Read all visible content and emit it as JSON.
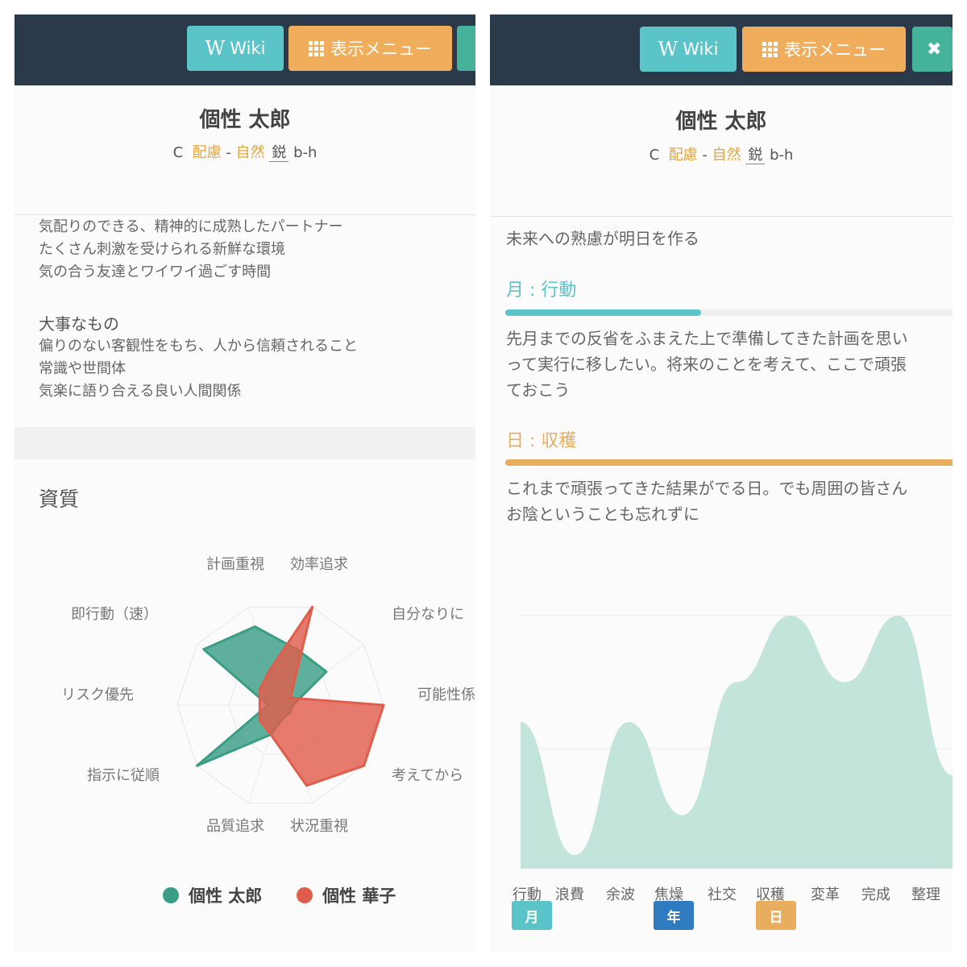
{
  "left": {
    "topbar": {
      "wiki_label": "Wiki",
      "wiki_icon": "wikipedia-icon",
      "menu_label": "表示メニュー",
      "menu_icon": "grid-icon"
    },
    "profile": {
      "name": "個性 太郎",
      "prefix": "C",
      "trait1": "配慮",
      "sep": "-",
      "trait2": "自然",
      "trait3": "鋭",
      "code": "b-h"
    },
    "needs_lines": [
      "気配りのできる、精神的に成熟したパートナー",
      "たくさん刺激を受けられる新鮮な環境",
      "気の合う友達とワイワイ過ごす時間"
    ],
    "important": {
      "heading": "大事なもの",
      "lines": [
        "偏りのない客観性をもち、人から信頼されること",
        "常識や世間体",
        "気楽に語り合える良い人間関係"
      ]
    },
    "section_title": "資質",
    "legend": [
      {
        "name": "個性 太郎",
        "color": "#3a9e85"
      },
      {
        "name": "個性 華子",
        "color": "#e05d4c"
      }
    ]
  },
  "right": {
    "topbar": {
      "wiki_label": "Wiki",
      "wiki_icon": "wikipedia-icon",
      "menu_label": "表示メニュー",
      "menu_icon": "grid-icon",
      "close_icon": "close-icon"
    },
    "profile": {
      "name": "個性 太郎",
      "prefix": "C",
      "trait1": "配慮",
      "sep": "-",
      "trait2": "自然",
      "trait3": "鋭",
      "code": "b-h"
    },
    "top_line": "未来への熟慮が明日を作る",
    "month": {
      "heading": "月 : 行動",
      "color": "#5bc4c9",
      "lines": [
        "先月までの反省をふまえた上で準備してきた計画を思い",
        "って実行に移したい。将来のことを考えて、ここで頑張",
        "ておこう"
      ]
    },
    "day": {
      "heading": "日 : 収穫",
      "color": "#e9ad5e",
      "lines": [
        "これまで頑張ってきた結果がでる日。でも周囲の皆さん",
        "お陰ということも忘れずに"
      ]
    },
    "badges": [
      {
        "label": "月",
        "color": "#5bc4c9"
      },
      {
        "label": "年",
        "color": "#2f7bbf"
      },
      {
        "label": "日",
        "color": "#e9ad5e"
      }
    ]
  },
  "chart_data": [
    {
      "type": "radar",
      "categories": [
        "計画重視",
        "効率追求",
        "自分なりに",
        "可能性係",
        "考えてから",
        "状況重視",
        "品質追求",
        "指示に従順",
        "リスク優先",
        "即行動（速）"
      ],
      "series": [
        {
          "name": "個性 太郎",
          "color": "#3a9e85",
          "values": [
            0.56,
            0.55,
            0.12,
            0.12,
            0.12,
            0.3,
            1.0,
            0.12,
            0.92,
            0.8
          ]
        },
        {
          "name": "個性 華子",
          "color": "#e05d4c",
          "values": [
            1.0,
            0.12,
            1.0,
            1.0,
            0.82,
            0.3,
            0.25,
            0.2,
            0.25,
            0.35
          ]
        }
      ]
    },
    {
      "type": "area",
      "categories": [
        "行動",
        "浪費",
        "余波",
        "焦燥",
        "社交",
        "収穫",
        "変革",
        "完成",
        "整理"
      ],
      "values": [
        0.6,
        0.1,
        0.6,
        0.25,
        0.75,
        1.0,
        0.75,
        1.0,
        0.4
      ],
      "color": "#c3e4db",
      "ylim": [
        0,
        1
      ]
    }
  ]
}
